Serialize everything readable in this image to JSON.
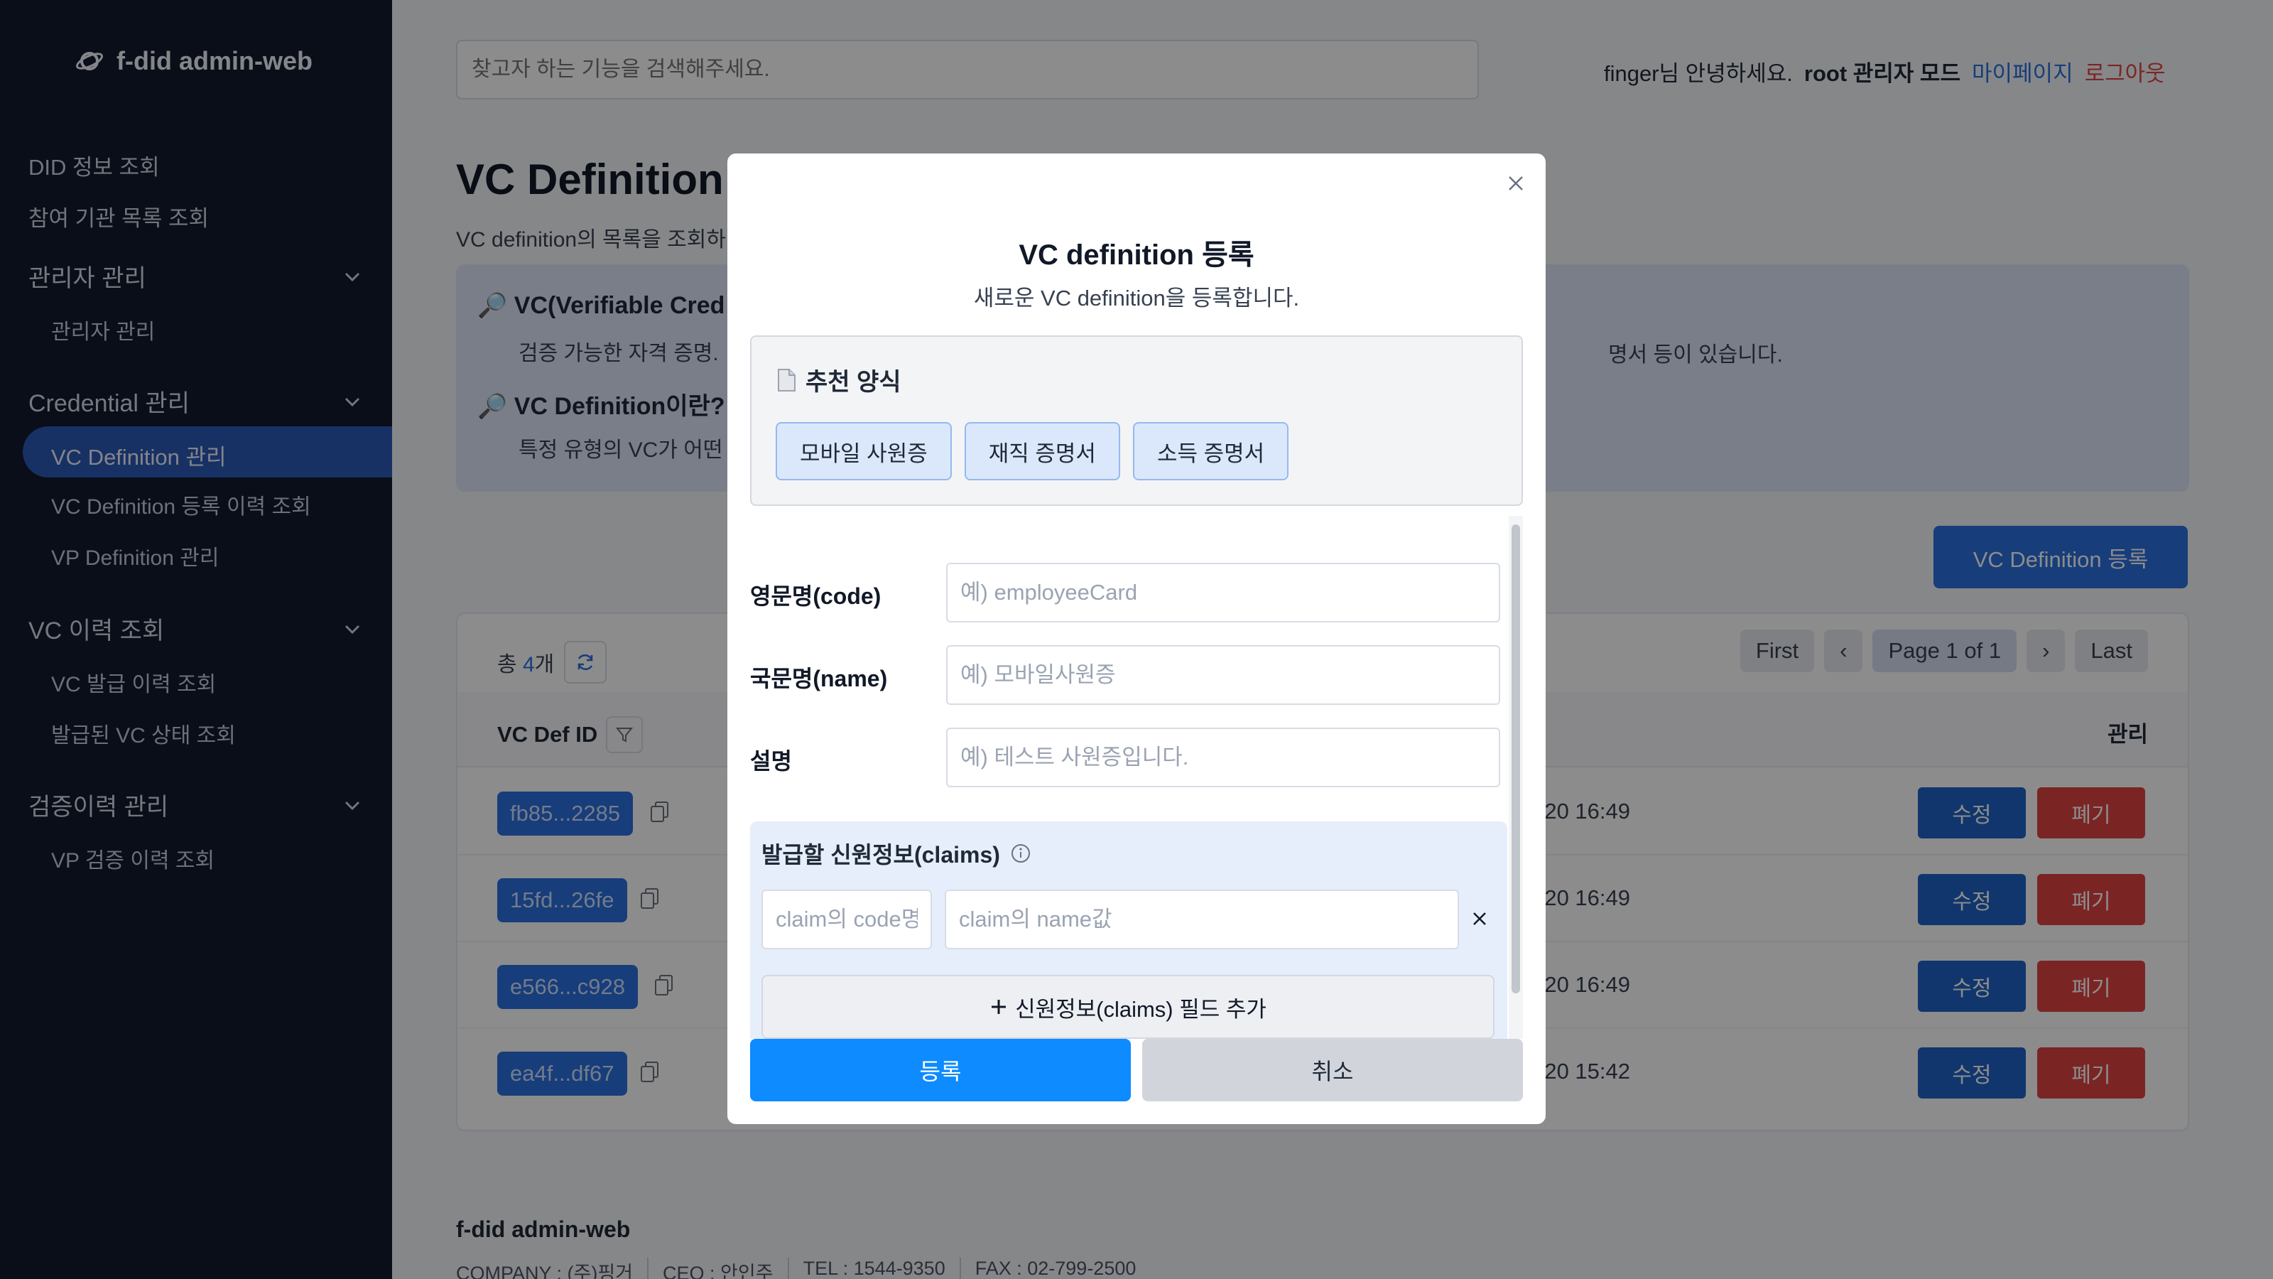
{
  "app": {
    "logo_text": "f-did admin-web"
  },
  "sidebar": {
    "items": [
      {
        "label": "DID 정보 조회"
      },
      {
        "label": "참여 기관 목록 조회"
      }
    ],
    "groups": [
      {
        "label": "관리자 관리",
        "children": [
          "관리자 관리"
        ]
      },
      {
        "label": "Credential 관리",
        "children": [
          "VC Definition 관리",
          "VC Definition 등록 이력 조회",
          "VP Definition 관리"
        ]
      },
      {
        "label": "VC 이력 조회",
        "children": [
          "VC 발급 이력 조회",
          "발급된 VC 상태 조회"
        ]
      },
      {
        "label": "검증이력 관리",
        "children": [
          "VP 검증 이력 조회"
        ]
      }
    ]
  },
  "header": {
    "search_placeholder": "찾고자 하는 기능을 검색해주세요.",
    "greeting": "finger님 안녕하세요.",
    "mode": "root 관리자 모드",
    "mypage": "마이페이지",
    "logout": "로그아웃"
  },
  "page": {
    "title": "VC Definition",
    "desc": "VC definition의 목록을 조회하",
    "info": {
      "h1": "VC(Verifiable Cred",
      "p1": "검증 가능한 자격 증명. ",
      "p1_right": "명서 등이 있습니다.",
      "h2": "VC Definition이란?",
      "p2": "특정 유형의 VC가 어떤"
    },
    "register_button": "VC Definition 등록"
  },
  "table": {
    "total_prefix": "총 ",
    "total_count": "4",
    "total_suffix": "개",
    "pager": {
      "first": "First",
      "prev": "‹",
      "page": "Page 1 of 1",
      "next": "›",
      "last": "Last"
    },
    "headers": {
      "id": "VC Def ID",
      "manage": "관리"
    },
    "rows": [
      {
        "id": "fb85...2285",
        "date": "-20 16:49",
        "edit": "수정",
        "del": "폐기"
      },
      {
        "id": "15fd...26fe",
        "date": "-20 16:49",
        "edit": "수정",
        "del": "폐기"
      },
      {
        "id": "e566...c928",
        "date": "-20 16:49",
        "edit": "수정",
        "del": "폐기"
      },
      {
        "id": "ea4f...df67",
        "date": "-20 15:42",
        "edit": "수정",
        "del": "폐기"
      }
    ]
  },
  "footer": {
    "name": "f-did admin-web",
    "company": "COMPANY : (주)핑거",
    "ceo": "CEO : 안인주",
    "tel": "TEL : 1544-9350",
    "fax": "FAX : 02-799-2500"
  },
  "modal": {
    "title": "VC definition 등록",
    "subtitle": "새로운 VC definition을 등록합니다.",
    "recommend_title": "추천 양식",
    "recommend": [
      "모바일 사원증",
      "재직 증명서",
      "소득 증명서"
    ],
    "fields": {
      "code_label": "영문명(code)",
      "code_placeholder": "예) employeeCard",
      "name_label": "국문명(name)",
      "name_placeholder": "예) 모바일사원증",
      "desc_label": "설명",
      "desc_placeholder": "예) 테스트 사원증입니다."
    },
    "claims": {
      "title": "발급할 신원정보(claims)",
      "code_placeholder": "claim의 code명",
      "name_placeholder": "claim의 name값",
      "add_label": "신원정보(claims) 필드 추가"
    },
    "submit": "등록",
    "cancel": "취소"
  },
  "colors": {
    "sidebar": "#111a2e",
    "accent": "#2b6fde",
    "danger": "#e04343",
    "submit": "#0d8bff"
  }
}
